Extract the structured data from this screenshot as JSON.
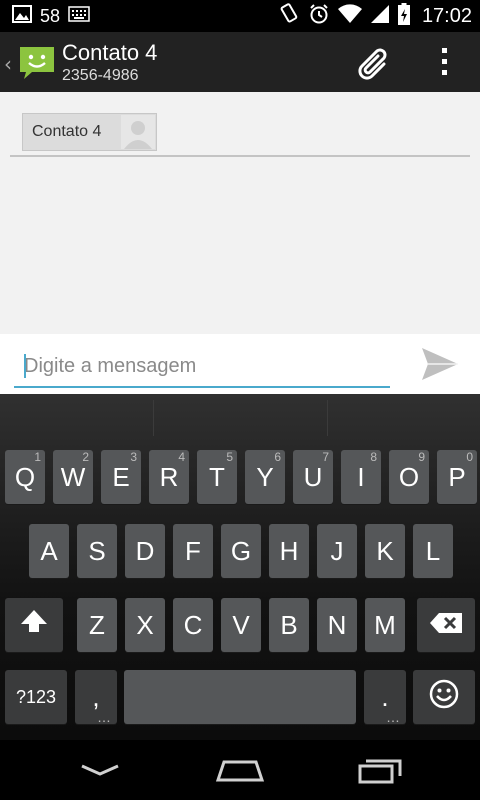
{
  "status_bar": {
    "notification_count": "58",
    "time": "17:02"
  },
  "action_bar": {
    "title": "Contato 4",
    "subtitle": "2356-4986"
  },
  "recipients": {
    "chips": [
      {
        "label": "Contato 4"
      }
    ]
  },
  "compose": {
    "placeholder": "Digite a mensagem",
    "value": ""
  },
  "keyboard": {
    "row1": [
      {
        "label": "Q",
        "hint": "1"
      },
      {
        "label": "W",
        "hint": "2"
      },
      {
        "label": "E",
        "hint": "3"
      },
      {
        "label": "R",
        "hint": "4"
      },
      {
        "label": "T",
        "hint": "5"
      },
      {
        "label": "Y",
        "hint": "6"
      },
      {
        "label": "U",
        "hint": "7"
      },
      {
        "label": "I",
        "hint": "8"
      },
      {
        "label": "O",
        "hint": "9"
      },
      {
        "label": "P",
        "hint": "0"
      }
    ],
    "row2": [
      {
        "label": "A"
      },
      {
        "label": "S"
      },
      {
        "label": "D"
      },
      {
        "label": "F"
      },
      {
        "label": "G"
      },
      {
        "label": "H"
      },
      {
        "label": "J"
      },
      {
        "label": "K"
      },
      {
        "label": "L"
      }
    ],
    "row3": [
      {
        "label": "Z"
      },
      {
        "label": "X"
      },
      {
        "label": "C"
      },
      {
        "label": "V"
      },
      {
        "label": "B"
      },
      {
        "label": "N"
      },
      {
        "label": "M"
      }
    ],
    "symbols_label": "?123",
    "comma_label": ",",
    "period_label": ".",
    "comma_sub": "…",
    "period_sub": "…"
  },
  "colors": {
    "accent": "#4aa9cc",
    "key": "#555759",
    "action_bar": "#222222",
    "app_icon": "#8cc43f"
  },
  "icons": [
    "gallery-icon",
    "keyboard-icon",
    "rotation-icon",
    "alarm-icon",
    "wifi-icon",
    "signal-icon",
    "battery-icon",
    "messaging-app-icon",
    "paperclip-icon",
    "overflow-menu-icon",
    "contact-photo-icon",
    "send-icon",
    "shift-icon",
    "backspace-icon",
    "emoji-icon",
    "nav-back-icon",
    "nav-home-icon",
    "nav-recents-icon"
  ]
}
